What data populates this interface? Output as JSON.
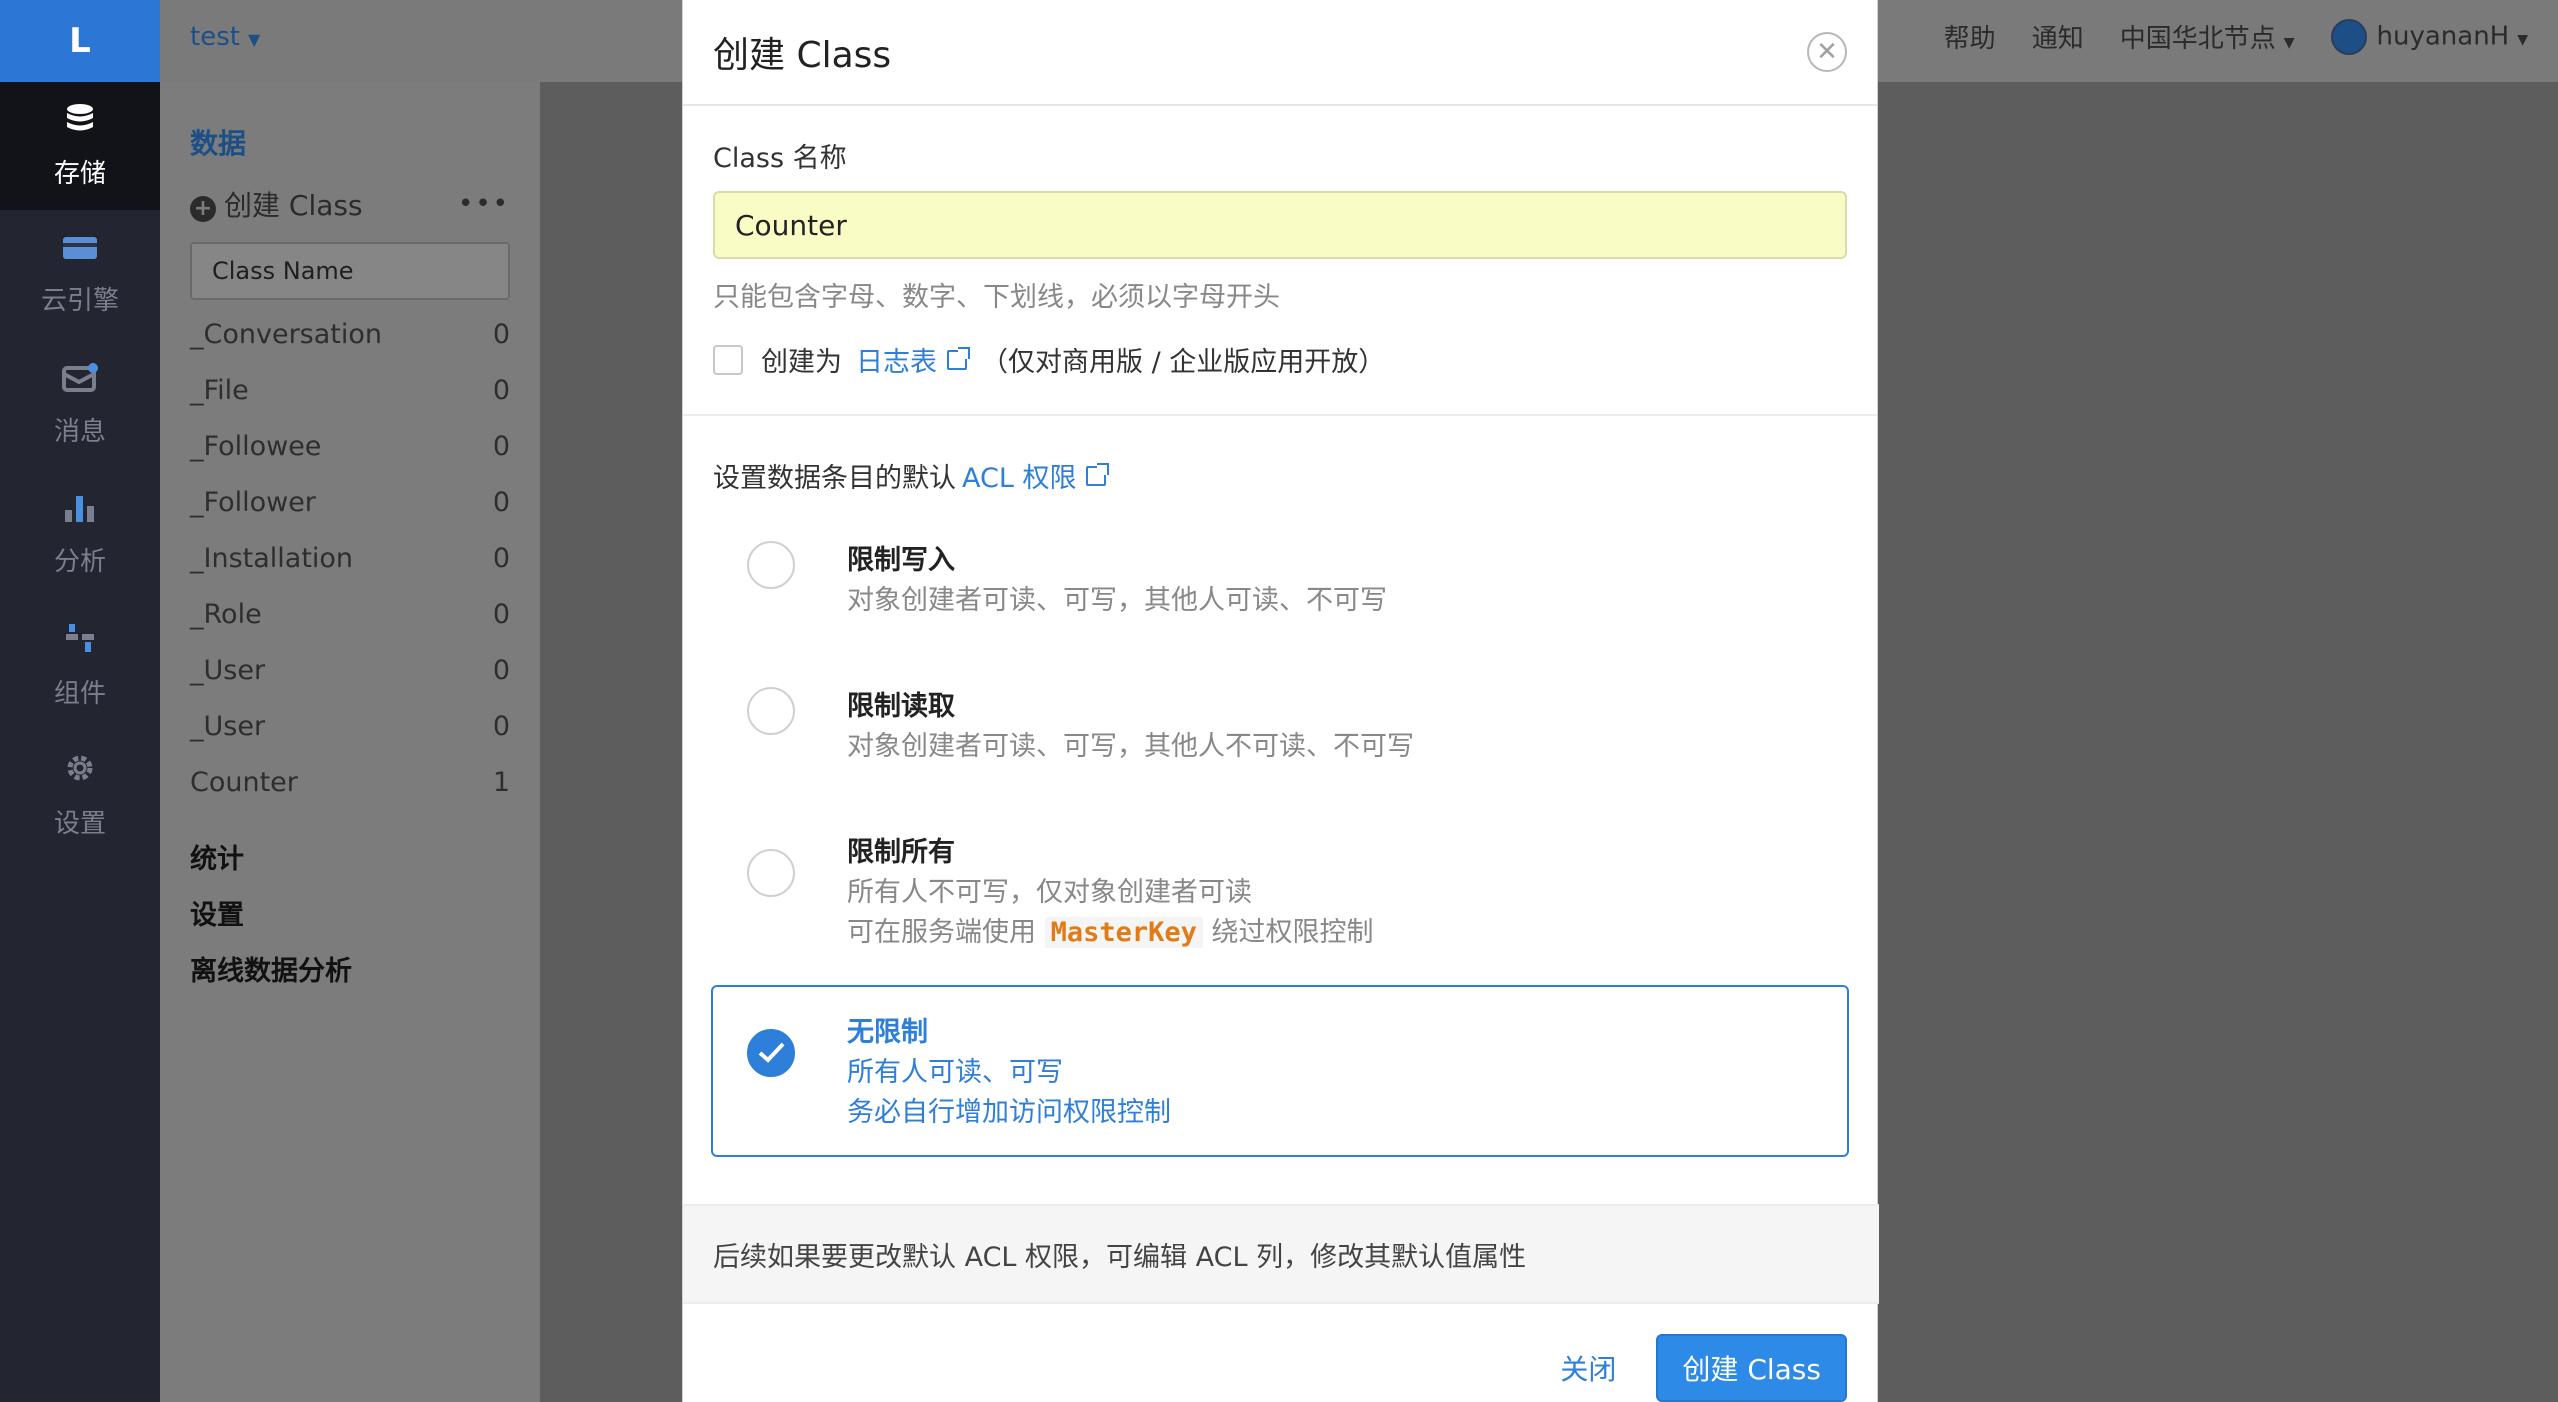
{
  "nav": {
    "logo": "L",
    "items": [
      {
        "label": "存储",
        "icon": "database-icon"
      },
      {
        "label": "云引擎",
        "icon": "server-icon"
      },
      {
        "label": "消息",
        "icon": "message-icon"
      },
      {
        "label": "分析",
        "icon": "bar-chart-icon"
      },
      {
        "label": "组件",
        "icon": "components-icon"
      },
      {
        "label": "设置",
        "icon": "gear-icon"
      }
    ]
  },
  "topbar": {
    "app_name": "test",
    "help": "帮助",
    "notice": "通知",
    "region": "中国华北节点",
    "user": "huyananH"
  },
  "sidebar": {
    "data_title": "数据",
    "create_class": "创建 Class",
    "class_name_placeholder": "Class Name",
    "classes": [
      {
        "name": "_Conversation",
        "count": "0"
      },
      {
        "name": "_File",
        "count": "0"
      },
      {
        "name": "_Followee",
        "count": "0"
      },
      {
        "name": "_Follower",
        "count": "0"
      },
      {
        "name": "_Installation",
        "count": "0"
      },
      {
        "name": "_Role",
        "count": "0"
      },
      {
        "name": "_User",
        "count": "0"
      },
      {
        "name": "_User",
        "count": "0"
      },
      {
        "name": "Counter",
        "count": "1"
      }
    ],
    "links": [
      "统计",
      "设置",
      "离线数据分析"
    ]
  },
  "modal": {
    "title": "创建 Class",
    "name_label": "Class 名称",
    "name_value": "Counter",
    "name_hint": "只能包含字母、数字、下划线，必须以字母开头",
    "log_prefix": "创建为",
    "log_link": "日志表",
    "log_suffix": "（仅对商用版 / 企业版应用开放）",
    "acl_prefix": "设置数据条目的默认",
    "acl_link": "ACL 权限",
    "options": [
      {
        "title": "限制写入",
        "desc": "对象创建者可读、可写，其他人可读、不可写"
      },
      {
        "title": "限制读取",
        "desc": "对象创建者可读、可写，其他人不可读、不可写"
      },
      {
        "title": "限制所有",
        "desc": "所有人不可写，仅对象创建者可读",
        "desc2_prefix": "可在服务端使用",
        "desc2_code": "MasterKey",
        "desc2_suffix": "绕过权限控制"
      },
      {
        "title": "无限制",
        "desc": "所有人可读、可写",
        "desc2": "务必自行增加访问权限控制"
      }
    ],
    "selected_option": "无限制",
    "footer_note": "后续如果要更改默认 ACL 权限，可编辑 ACL 列，修改其默认值属性",
    "close_label": "关闭",
    "submit_label": "创建 Class"
  },
  "colors": {
    "accent": "#2d7fd9",
    "nav_bg": "#232631",
    "logo_bg": "#2c76d6",
    "input_highlight": "#fafcc5"
  }
}
